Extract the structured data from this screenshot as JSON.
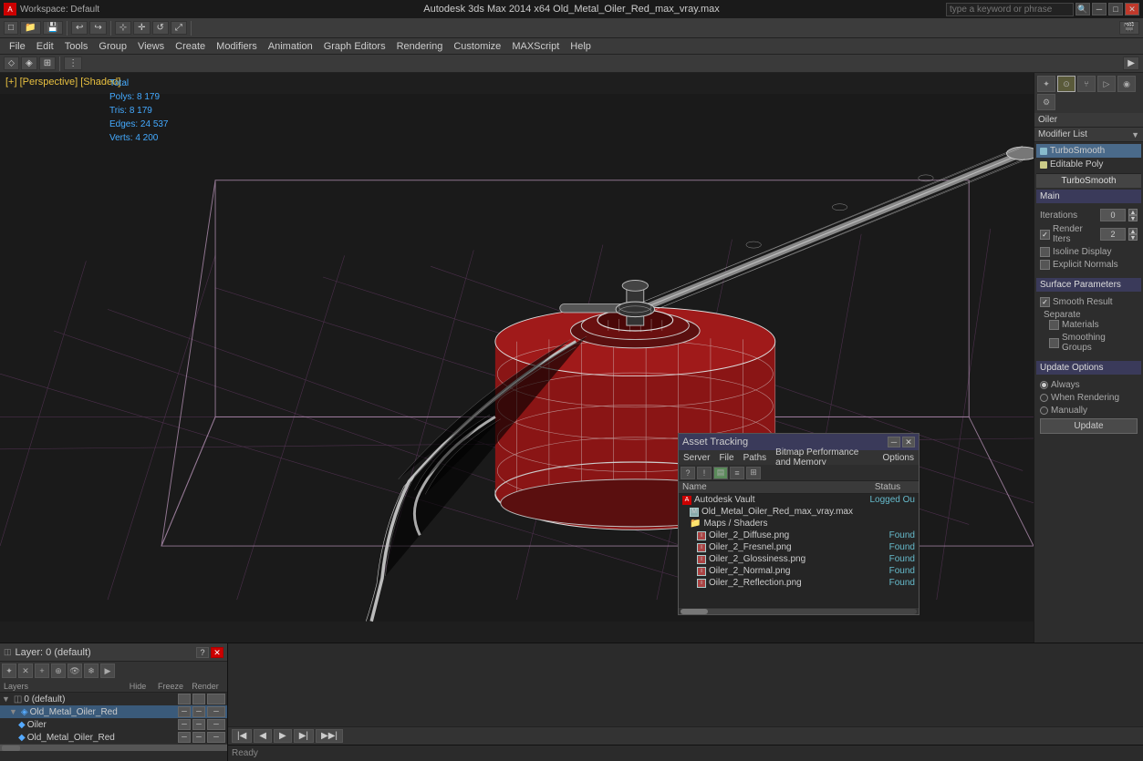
{
  "titlebar": {
    "workspace_label": "Workspace: Default",
    "title": "Autodesk 3ds Max 2014 x64    Old_Metal_Oiler_Red_max_vray.max",
    "search_placeholder": "type a keyword or phrase"
  },
  "menubar": {
    "items": [
      "File",
      "Edit",
      "Tools",
      "Group",
      "Views",
      "Create",
      "Modifiers",
      "Animation",
      "Graph Editors",
      "Rendering",
      "Customize",
      "MAXScript",
      "Help"
    ]
  },
  "viewport": {
    "label": "[+] [Perspective] [Shaded]",
    "stats_label": "Total",
    "polys": "Polys:  8 179",
    "tris": "Tris:   8 179",
    "edges": "Edges: 24 537",
    "verts": "Verts: 4 200"
  },
  "right_panel": {
    "object_name": "Oiler",
    "modifier_list_label": "Modifier List",
    "modifiers": [
      {
        "name": "TurboSmooth",
        "type": "modifier"
      },
      {
        "name": "Editable Poly",
        "type": "base"
      }
    ],
    "turbosmooth": {
      "title": "TurboSmooth",
      "main_label": "Main",
      "iterations_label": "Iterations",
      "iterations_value": "0",
      "render_iters_label": "Render Iters",
      "render_iters_value": "2",
      "render_iters_checked": true,
      "isoline_label": "Isoline Display",
      "explicit_normals_label": "Explicit Normals",
      "surface_params_label": "Surface Parameters",
      "smooth_result_label": "Smooth Result",
      "smooth_result_checked": true,
      "separate_label": "Separate",
      "materials_label": "Materials",
      "smoothing_groups_label": "Smoothing Groups",
      "update_options_label": "Update Options",
      "always_label": "Always",
      "when_rendering_label": "When Rendering",
      "manually_label": "Manually",
      "update_btn_label": "Update"
    }
  },
  "layers": {
    "title": "Layer: 0 (default)",
    "columns": {
      "name": "Layers",
      "hide": "Hide",
      "freeze": "Freeze",
      "render": "Render"
    },
    "items": [
      {
        "name": "0 (default)",
        "indent": 0,
        "type": "layer"
      },
      {
        "name": "Old_Metal_Oiler_Red",
        "indent": 1,
        "type": "object",
        "selected": true
      },
      {
        "name": "Oiler",
        "indent": 2,
        "type": "object"
      },
      {
        "name": "Old_Metal_Oiler_Red",
        "indent": 2,
        "type": "object"
      }
    ]
  },
  "asset_tracking": {
    "title": "Asset Tracking",
    "menus": [
      "Server",
      "File",
      "Paths",
      "Bitmap Performance and Memory",
      "Options"
    ],
    "columns": {
      "name": "Name",
      "status": "Status"
    },
    "items": [
      {
        "name": "Autodesk Vault",
        "indent": 0,
        "type": "vault",
        "status": "Logged Ou"
      },
      {
        "name": "Old_Metal_Oiler_Red_max_vray.max",
        "indent": 1,
        "type": "file",
        "status": ""
      },
      {
        "name": "Maps / Shaders",
        "indent": 1,
        "type": "folder",
        "status": ""
      },
      {
        "name": "Oiler_2_Diffuse.png",
        "indent": 2,
        "type": "image",
        "status": "Found"
      },
      {
        "name": "Oiler_2_Fresnel.png",
        "indent": 2,
        "type": "image",
        "status": "Found"
      },
      {
        "name": "Oiler_2_Glossiness.png",
        "indent": 2,
        "type": "image",
        "status": "Found"
      },
      {
        "name": "Oiler_2_Normal.png",
        "indent": 2,
        "type": "image",
        "status": "Found"
      },
      {
        "name": "Oiler_2_Reflection.png",
        "indent": 2,
        "type": "image",
        "status": "Found"
      }
    ]
  }
}
